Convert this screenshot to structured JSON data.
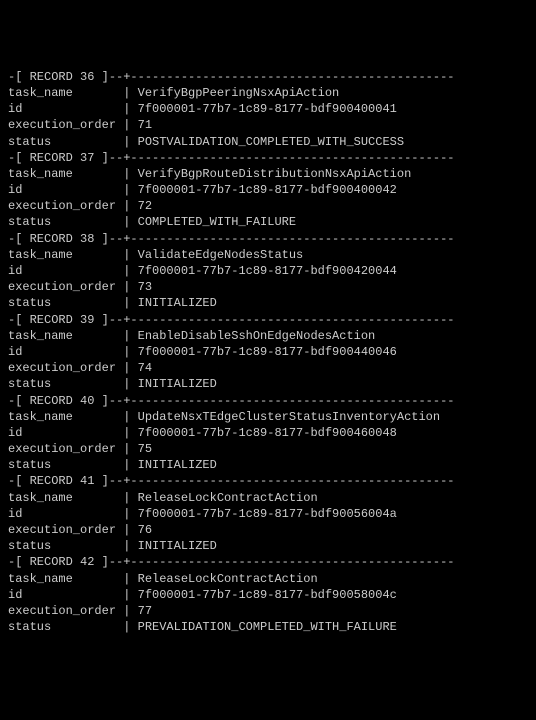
{
  "records": [
    {
      "header": "-[ RECORD 36 ]--+---------------------------------------------",
      "fields": [
        {
          "label": "task_name      ",
          "value": "VerifyBgpPeeringNsxApiAction"
        },
        {
          "label": "id             ",
          "value": "7f000001-77b7-1c89-8177-bdf900400041"
        },
        {
          "label": "execution_order",
          "value": "71"
        },
        {
          "label": "status         ",
          "value": "POSTVALIDATION_COMPLETED_WITH_SUCCESS"
        }
      ]
    },
    {
      "header": "-[ RECORD 37 ]--+---------------------------------------------",
      "fields": [
        {
          "label": "task_name      ",
          "value": "VerifyBgpRouteDistributionNsxApiAction"
        },
        {
          "label": "id             ",
          "value": "7f000001-77b7-1c89-8177-bdf900400042"
        },
        {
          "label": "execution_order",
          "value": "72"
        },
        {
          "label": "status         ",
          "value": "COMPLETED_WITH_FAILURE"
        }
      ]
    },
    {
      "header": "-[ RECORD 38 ]--+---------------------------------------------",
      "fields": [
        {
          "label": "task_name      ",
          "value": "ValidateEdgeNodesStatus"
        },
        {
          "label": "id             ",
          "value": "7f000001-77b7-1c89-8177-bdf900420044"
        },
        {
          "label": "execution_order",
          "value": "73"
        },
        {
          "label": "status         ",
          "value": "INITIALIZED"
        }
      ]
    },
    {
      "header": "-[ RECORD 39 ]--+---------------------------------------------",
      "fields": [
        {
          "label": "task_name      ",
          "value": "EnableDisableSshOnEdgeNodesAction"
        },
        {
          "label": "id             ",
          "value": "7f000001-77b7-1c89-8177-bdf900440046"
        },
        {
          "label": "execution_order",
          "value": "74"
        },
        {
          "label": "status         ",
          "value": "INITIALIZED"
        }
      ]
    },
    {
      "header": "-[ RECORD 40 ]--+---------------------------------------------",
      "fields": [
        {
          "label": "task_name      ",
          "value": "UpdateNsxTEdgeClusterStatusInventoryAction"
        },
        {
          "label": "id             ",
          "value": "7f000001-77b7-1c89-8177-bdf900460048"
        },
        {
          "label": "execution_order",
          "value": "75"
        },
        {
          "label": "status         ",
          "value": "INITIALIZED"
        }
      ]
    },
    {
      "header": "-[ RECORD 41 ]--+---------------------------------------------",
      "fields": [
        {
          "label": "task_name      ",
          "value": "ReleaseLockContractAction"
        },
        {
          "label": "id             ",
          "value": "7f000001-77b7-1c89-8177-bdf90056004a"
        },
        {
          "label": "execution_order",
          "value": "76"
        },
        {
          "label": "status         ",
          "value": "INITIALIZED"
        }
      ]
    },
    {
      "header": "-[ RECORD 42 ]--+---------------------------------------------",
      "fields": [
        {
          "label": "task_name      ",
          "value": "ReleaseLockContractAction"
        },
        {
          "label": "id             ",
          "value": "7f000001-77b7-1c89-8177-bdf90058004c"
        },
        {
          "label": "execution_order",
          "value": "77"
        },
        {
          "label": "status         ",
          "value": "PREVALIDATION_COMPLETED_WITH_FAILURE"
        }
      ]
    }
  ]
}
